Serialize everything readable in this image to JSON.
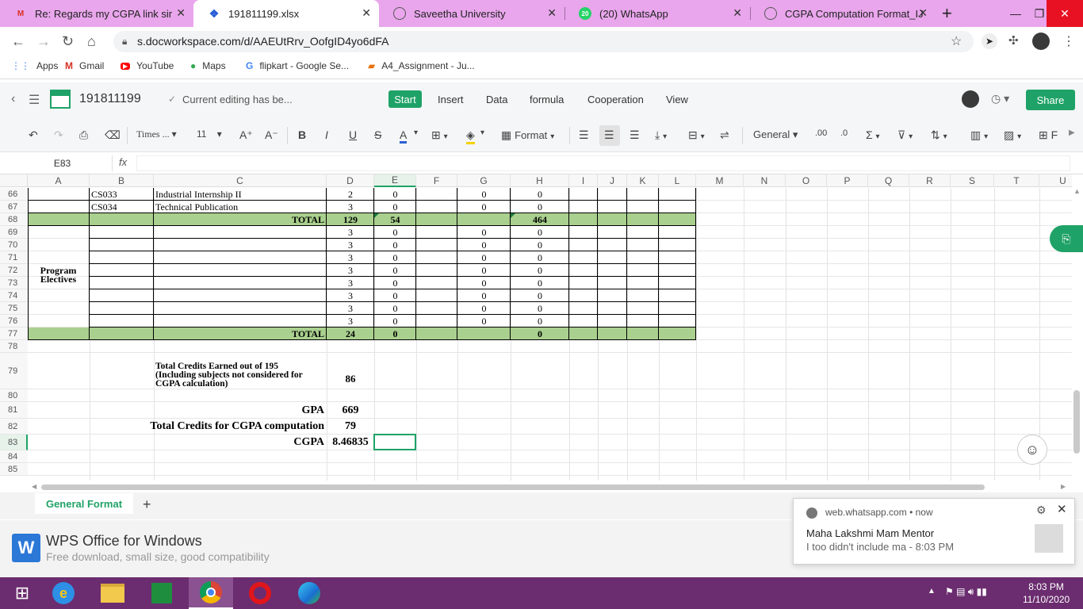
{
  "browser": {
    "tabs": [
      {
        "title": "Re: Regards my CGPA link sir - r",
        "icon": "gmail-icon",
        "active": false
      },
      {
        "title": "191811199.xlsx",
        "icon": "wps-docs-icon",
        "active": true
      },
      {
        "title": "Saveetha University",
        "icon": "globe-icon",
        "active": false
      },
      {
        "title": "(20) WhatsApp",
        "icon": "whatsapp-icon",
        "active": false
      },
      {
        "title": "CGPA Computation Format_IJT_",
        "icon": "globe-icon",
        "active": false
      }
    ],
    "url": "s.docworkspace.com/d/AAEUtRrv_OofgID4yo6dFA",
    "bookmarks": [
      "Apps",
      "Gmail",
      "YouTube",
      "Maps",
      "flipkart - Google Se...",
      "A4_Assignment - Ju..."
    ]
  },
  "app": {
    "filename": "191811199",
    "status": "Current editing has be...",
    "menus": [
      "Start",
      "Insert",
      "Data",
      "formula",
      "Cooperation",
      "View"
    ],
    "share_label": "Share"
  },
  "toolbar": {
    "font_name": "Times ...",
    "font_size": "11",
    "format_label": "Format",
    "number_format": "General"
  },
  "formula_bar": {
    "cell_ref": "E83",
    "fx_label": "fx",
    "value": ""
  },
  "grid": {
    "columns": [
      "A",
      "B",
      "C",
      "D",
      "E",
      "F",
      "G",
      "H",
      "I",
      "J",
      "K",
      "L",
      "M",
      "N",
      "O",
      "P",
      "Q",
      "R",
      "S",
      "T",
      "U"
    ],
    "selected_column": "E",
    "selected_row": "83",
    "rows": [
      "66",
      "67",
      "68",
      "69",
      "70",
      "71",
      "72",
      "73",
      "74",
      "75",
      "76",
      "77",
      "78",
      "79",
      "80",
      "81",
      "82",
      "83",
      "84",
      "85"
    ],
    "section_label": "Program Electives",
    "courses": [
      {
        "code": "CS033",
        "name": "Industrial Internship II",
        "credits": "2",
        "e": "0",
        "g": "0",
        "h": "0"
      },
      {
        "code": "CS034",
        "name": "Technical Publication",
        "credits": "3",
        "e": "0",
        "g": "0",
        "h": "0"
      }
    ],
    "total1": {
      "label": "TOTAL",
      "d": "129",
      "e": "54",
      "h": "464"
    },
    "electives": [
      {
        "d": "3",
        "e": "0",
        "g": "0",
        "h": "0"
      },
      {
        "d": "3",
        "e": "0",
        "g": "0",
        "h": "0"
      },
      {
        "d": "3",
        "e": "0",
        "g": "0",
        "h": "0"
      },
      {
        "d": "3",
        "e": "0",
        "g": "0",
        "h": "0"
      },
      {
        "d": "3",
        "e": "0",
        "g": "0",
        "h": "0"
      },
      {
        "d": "3",
        "e": "0",
        "g": "0",
        "h": "0"
      },
      {
        "d": "3",
        "e": "0",
        "g": "0",
        "h": "0"
      },
      {
        "d": "3",
        "e": "0",
        "g": "0",
        "h": "0"
      }
    ],
    "total2": {
      "label": "TOTAL",
      "d": "24",
      "e": "0",
      "h": "0"
    },
    "summary": {
      "credits_note_1": "Total Credits Earned out of 195",
      "credits_note_2": "(Including subjects not considered for",
      "credits_note_3": "CGPA calculation)",
      "credits_value": "86",
      "gpa_label": "GPA",
      "gpa_value": "669",
      "tc_label": "Total Credits for CGPA computation",
      "tc_value": "79",
      "cgpa_label": "CGPA",
      "cgpa_value": "8.46835"
    }
  },
  "sheets": {
    "active": "General Format",
    "add": "+"
  },
  "wps_banner": {
    "title": "WPS Office for Windows",
    "subtitle": "Free download, small size, good compatibility"
  },
  "notification": {
    "source": "web.whatsapp.com",
    "when": "now",
    "sender": "Maha Lakshmi Mam Mentor",
    "message": "I too didn't include ma - 8:03 PM"
  },
  "taskbar": {
    "time": "8:03 PM",
    "date": "11/10/2020"
  },
  "colors": {
    "accent": "#1fa267",
    "tabbar": "#e9a6ec",
    "taskbar": "#6b2d6f",
    "total_band": "#a9d08e"
  }
}
